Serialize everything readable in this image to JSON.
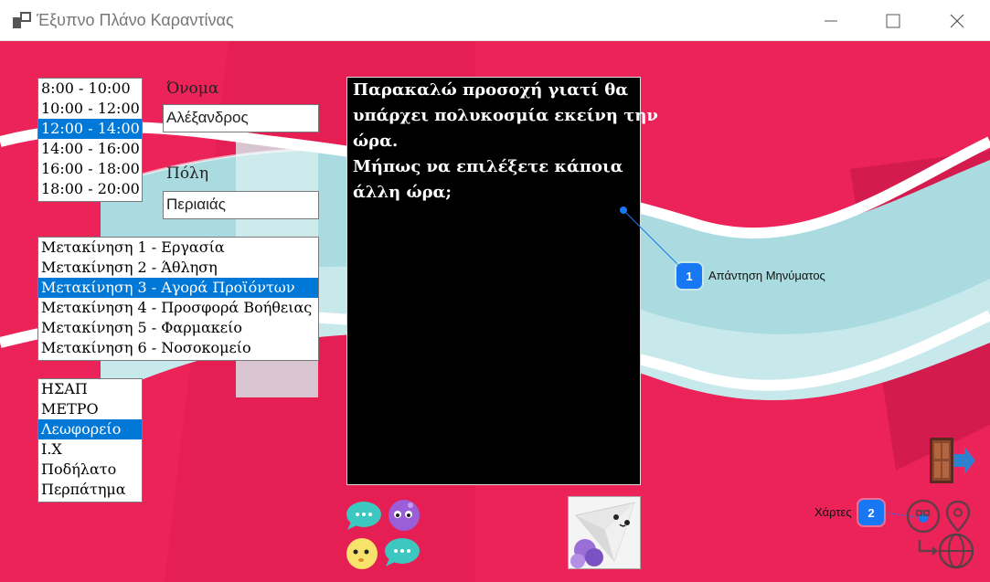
{
  "window": {
    "title": "Έξυπνο Πλάνο Καραντίνας",
    "minimize_glyph": "—",
    "maximize_glyph": "☐",
    "close_glyph": "✕"
  },
  "time_slots": {
    "items": [
      "8:00 - 10:00",
      "10:00 - 12:00",
      "12:00 - 14:00",
      "14:00 - 16:00",
      "16:00 - 18:00",
      "18:00 - 20:00"
    ],
    "selected_index": 2
  },
  "name": {
    "label": "Όνομα",
    "value": "Αλέξανδρος"
  },
  "city": {
    "label": "Πόλη",
    "value": "Περιαιάς"
  },
  "movement_reasons": {
    "items": [
      "Μετακίνηση 1 - Εργασία",
      "Μετακίνηση 2 - Άθληση",
      "Μετακίνηση 3 - Αγορά Προϊόντων",
      "Μετακίνηση 4 - Προσφορά Βοήθειας",
      "Μετακίνηση 5 - Φαρμακείο",
      "Μετακίνηση 6 - Νοσοκομείο"
    ],
    "selected_index": 2
  },
  "transport": {
    "items": [
      "ΗΣΑΠ",
      "ΜΕΤΡΟ",
      "Λεωφορείο",
      "Ι.Χ",
      "Ποδήλατο",
      "Περπάτημα"
    ],
    "selected_index": 2
  },
  "message": {
    "lines": [
      "Παρακαλώ προσοχή γιατί θα",
      "υπάρχει πολυκοσμία εκείνη την",
      "ώρα.",
      "Μήπως να επιλέξετε κάποια",
      "άλλη ώρα;"
    ]
  },
  "annotations": [
    {
      "number": "1",
      "label": "Απάντηση Μηνύματος"
    },
    {
      "number": "2",
      "label": "Χάρτες"
    }
  ],
  "icons": {
    "exit": "door-exit-icon",
    "maps": "map-pin-globe-icon",
    "chat_teal": "chat-bubble-teal-icon",
    "purple_face": "purple-face-icon",
    "yellow_face": "yellow-face-icon",
    "chat_teal_2": "chat-bubble-teal-2-icon",
    "paper_plane": "paper-plane-icon"
  },
  "colors": {
    "background": "#ec2359",
    "selection": "#0078d7",
    "callout": "#1877f2",
    "message_panel": "#000000"
  }
}
